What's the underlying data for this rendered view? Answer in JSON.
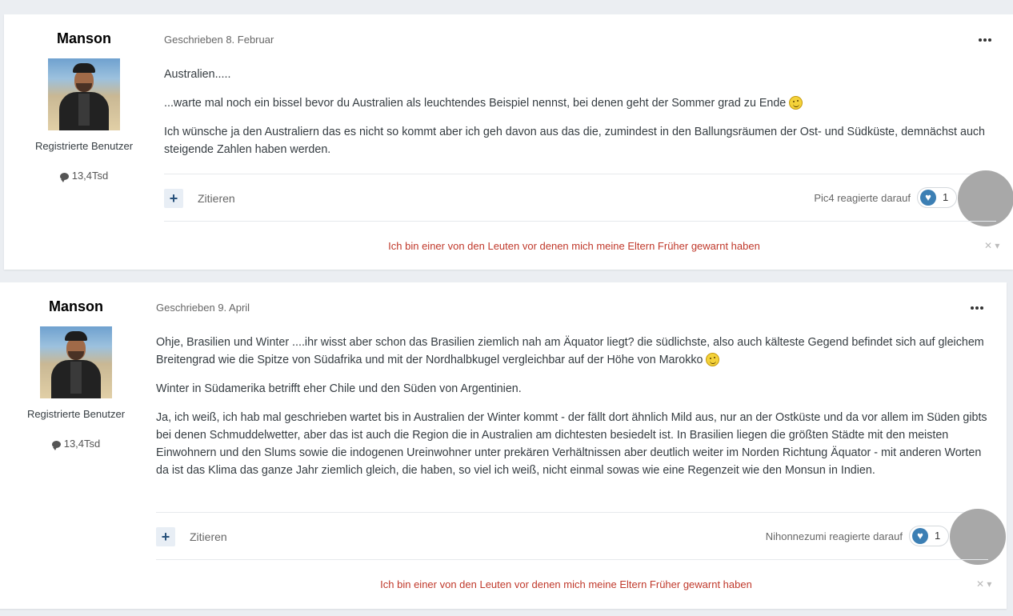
{
  "posts": [
    {
      "author": {
        "name": "Manson",
        "group": "Registrierte Benutzer",
        "post_count": "13,4Tsd"
      },
      "date": "Geschrieben 8. Februar",
      "paragraphs": [
        "Australien.....",
        "...warte mal noch ein bissel bevor du Australien als leuchtendes Beispiel nennst, bei denen geht der Sommer grad zu Ende",
        "Ich wünsche ja den Australiern das es nicht so kommt aber ich geh davon aus das die, zumindest in den Ballungsräumen der Ost- und Südküste, demnächst auch steigende Zahlen haben werden."
      ],
      "quote_label": "Zitieren",
      "reaction_text": "Pic4 reagierte darauf",
      "reaction_count": "1",
      "signature": "Ich bin einer von den Leuten vor denen mich meine Eltern Früher gewarnt haben"
    },
    {
      "author": {
        "name": "Manson",
        "group": "Registrierte Benutzer",
        "post_count": "13,4Tsd"
      },
      "date": "Geschrieben 9. April",
      "paragraphs": [
        "Ohje, Brasilien und Winter ....ihr wisst aber schon das Brasilien ziemlich nah am Äquator liegt? die südlichste, also auch kälteste Gegend befindet sich auf gleichem Breitengrad wie die Spitze von Südafrika und mit der Nordhalbkugel vergleichbar auf der Höhe von Marokko",
        "Winter in Südamerika betrifft eher Chile und den Süden von Argentinien.",
        "Ja, ich weiß, ich hab mal geschrieben wartet bis in Australien der Winter kommt - der fällt dort ähnlich Mild aus, nur an der Ostküste und da vor allem im Süden gibts bei denen Schmuddelwetter, aber das ist auch die Region die in Australien am dichtesten besiedelt ist. In Brasilien liegen die größten Städte mit den meisten Einwohnern und den Slums sowie die indogenen Ureinwohner unter prekären Verhältnissen aber deutlich weiter im Norden Richtung Äquator - mit anderen Worten da ist das Klima das ganze Jahr ziemlich gleich, die haben, so viel ich weiß, nicht einmal sowas wie eine Regenzeit wie den Monsun in Indien."
      ],
      "quote_label": "Zitieren",
      "reaction_text": "Nihonnezumi reagierte darauf",
      "reaction_count": "1",
      "signature": "Ich bin einer von den Leuten vor denen mich meine Eltern Früher gewarnt haben"
    }
  ]
}
